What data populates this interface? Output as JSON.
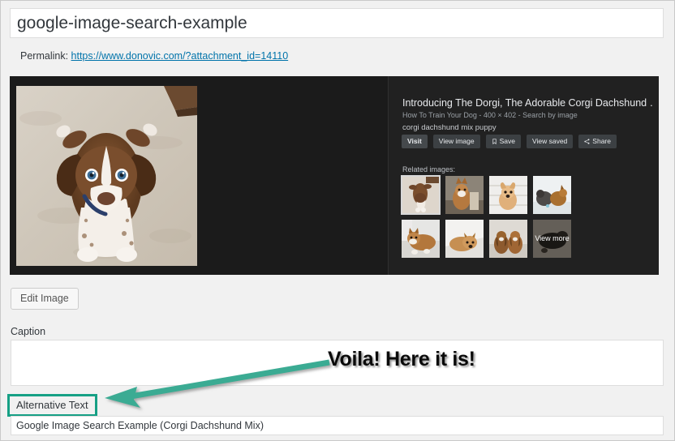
{
  "page": {
    "title_value": "google-image-search-example",
    "permalink_label": "Permalink:",
    "permalink_url": "https://www.donovic.com/?attachment_id=14110"
  },
  "media": {
    "google_panel": {
      "result_title": "Introducing The Dorgi, The Adorable Corgi Dachshund …",
      "result_meta": "How To Train Your Dog - 400 × 402 - Search by image",
      "query_text": "corgi dachshund mix puppy",
      "buttons": [
        {
          "label": "Visit",
          "icon": null
        },
        {
          "label": "View image",
          "icon": null
        },
        {
          "label": "Save",
          "icon": "bookmark-icon"
        },
        {
          "label": "View saved",
          "icon": null
        },
        {
          "label": "Share",
          "icon": "share-icon"
        }
      ],
      "related_label": "Related images:",
      "related_thumbs": [
        {
          "name": "thumb-1",
          "selected": true,
          "overlay": null
        },
        {
          "name": "thumb-2",
          "selected": false,
          "overlay": null
        },
        {
          "name": "thumb-3",
          "selected": false,
          "overlay": null
        },
        {
          "name": "thumb-4",
          "selected": false,
          "overlay": null
        },
        {
          "name": "thumb-5",
          "selected": false,
          "overlay": null
        },
        {
          "name": "thumb-6",
          "selected": false,
          "overlay": null
        },
        {
          "name": "thumb-7",
          "selected": false,
          "overlay": null
        },
        {
          "name": "thumb-8",
          "selected": false,
          "overlay": "View more"
        }
      ]
    }
  },
  "form": {
    "edit_image_label": "Edit Image",
    "caption_label": "Caption",
    "caption_value": "",
    "alt_label": "Alternative Text",
    "alt_value": "Google Image Search Example (Corgi Dachshund Mix)"
  },
  "annotation": {
    "text": "Voila! Here it is!",
    "arrow_color": "#3aab93",
    "highlight_color": "#16a085"
  }
}
